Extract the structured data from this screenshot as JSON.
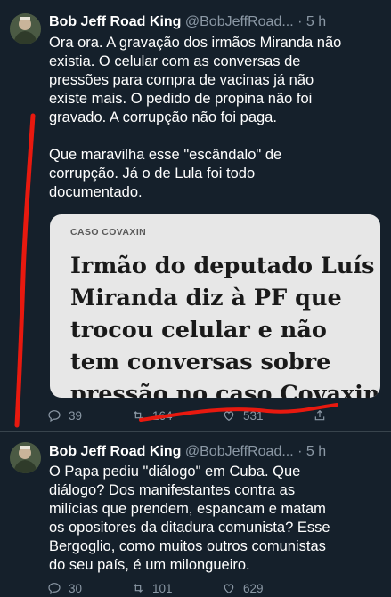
{
  "tweets": [
    {
      "name": "Bob Jeff Road King",
      "handle": "@BobJeffRoad...",
      "time": "· 5 h",
      "paragraph1": [
        "Ora ora. A gravação dos irmãos Miranda não",
        "existia. O celular com as conversas de",
        "pressões para compra de vacinas já não",
        "existe mais. O pedido de propina não foi",
        "gravado. A corrupção não foi paga."
      ],
      "paragraph2": [
        "Que maravilha esse \"escândalo\" de",
        "corrupção. Já o de Lula foi todo",
        "documentado."
      ],
      "card": {
        "kicker": "CASO COVAXIN",
        "headline": [
          "Irmão do deputado Luís",
          "Miranda diz à PF que",
          "trocou celular e não",
          "tem conversas sobre",
          "pressão no caso Covaxin"
        ]
      },
      "replies": "39",
      "retweets": "164",
      "likes": "531"
    },
    {
      "name": "Bob Jeff Road King",
      "handle": "@BobJeffRoad...",
      "time": "· 5 h",
      "paragraph1": [
        "O Papa pediu \"diálogo\" em Cuba. Que",
        "diálogo? Dos manifestantes contra as",
        "milícias que prendem, espancam e matam",
        "os opositores da ditadura comunista? Esse",
        "Bergoglio, como muitos outros comunistas",
        "do seu país, é um milongueiro."
      ],
      "replies": "30",
      "retweets": "101",
      "likes": "629"
    }
  ],
  "colors": {
    "background": "#15202b",
    "text": "#ffffff",
    "muted": "#8b98a5",
    "separator": "#38444d",
    "annotation_red": "#e8190f"
  },
  "icons": [
    "reply-icon",
    "retweet-icon",
    "like-icon",
    "share-icon"
  ]
}
